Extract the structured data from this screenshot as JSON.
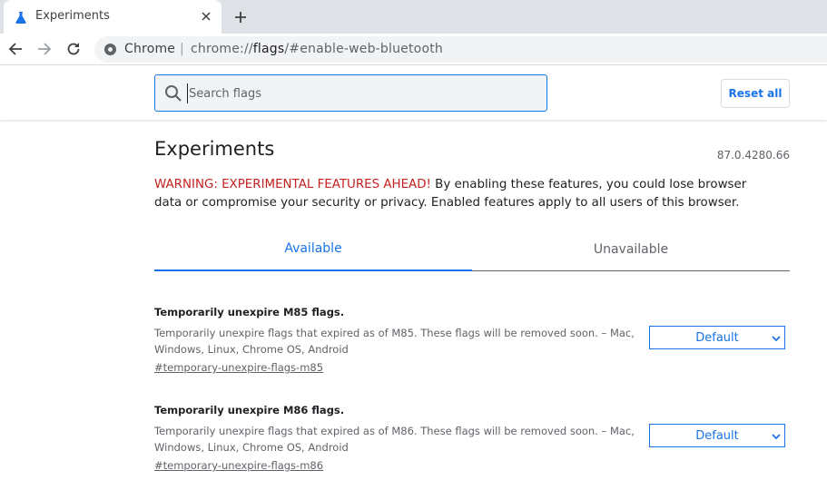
{
  "tab": {
    "title": "Experiments"
  },
  "omnibox": {
    "scheme_label": "Chrome",
    "separator": "|",
    "url_prefix": "chrome://",
    "url_host": "flags",
    "url_suffix": "/#enable-web-bluetooth"
  },
  "header": {
    "search_placeholder": "Search flags",
    "reset_label": "Reset all"
  },
  "main": {
    "title": "Experiments",
    "version": "87.0.4280.66",
    "warning_red": "WARNING: EXPERIMENTAL FEATURES AHEAD!",
    "warning_rest": " By enabling these features, you could lose browser data or compromise your security or privacy. Enabled features apply to all users of this browser.",
    "tabs": [
      {
        "label": "Available",
        "selected": true
      },
      {
        "label": "Unavailable",
        "selected": false
      }
    ]
  },
  "flags": [
    {
      "name": "Temporarily unexpire M85 flags.",
      "description": "Temporarily unexpire flags that expired as of M85. These flags will be removed soon. – Mac, Windows, Linux, Chrome OS, Android",
      "link": "#temporary-unexpire-flags-m85",
      "value": "Default"
    },
    {
      "name": "Temporarily unexpire M86 flags.",
      "description": "Temporarily unexpire flags that expired as of M86. These flags will be removed soon. – Mac, Windows, Linux, Chrome OS, Android",
      "link": "#temporary-unexpire-flags-m86",
      "value": "Default"
    }
  ],
  "colors": {
    "accent": "#1a73e8",
    "warning": "#c5221f"
  },
  "icons": {
    "favicon": "flask-icon",
    "tab_close": "close-icon",
    "new_tab": "plus-icon",
    "back": "back-arrow-icon",
    "forward": "forward-arrow-icon",
    "reload": "reload-icon",
    "site_info": "chrome-info-icon",
    "search": "search-icon",
    "select": "chevron-down-icon"
  }
}
